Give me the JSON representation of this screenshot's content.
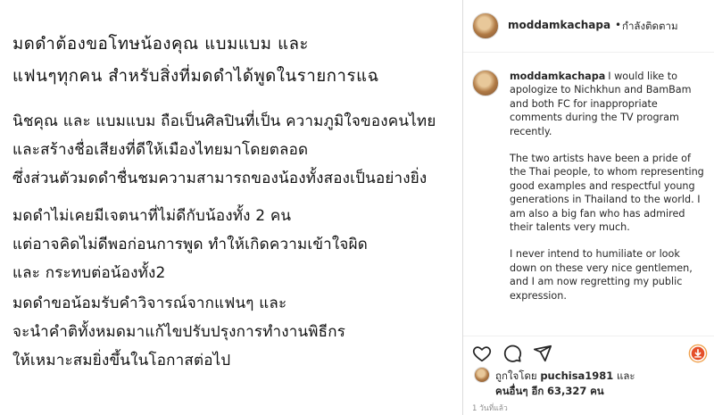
{
  "post_image": {
    "heading": [
      "มดดำต้องขอโทษน้องคุณ แบมแบม และ",
      "แฟนๆทุกคน สำหรับสิ่งที่มดดำได้พูดในรายการแฉ"
    ],
    "para1": [
      "นิชคุณ และ แบมแบม ถือเป็นศิลปินที่เป็น ความภูมิใจของคนไทย",
      "และสร้างชื่อเสียงที่ดีให้เมืองไทยมาโดยตลอด",
      "ซึ่งส่วนตัวมดดำชื่นชมความสามารถของน้องทั้งสองเป็นอย่างยิ่ง"
    ],
    "para2": [
      "มดดำไม่เคยมีเจตนาที่ไม่ดีกับน้องทั้ง 2 คน",
      "แต่อาจคิดไม่ดีพอก่อนการพูด ทำให้เกิดความเข้าใจผิด",
      " และ กระทบต่อน้องทั้ง2"
    ],
    "para3": [
      "มดดำขอน้อมรับคำวิจารณ์จากแฟนๆ และ",
      "จะนำคำติทั้งหมดมาแก้ไขปรับปรุงการทำงานพิธีกร",
      "ให้เหมาะสมยิ่งขึ้นในโอกาสต่อไป"
    ]
  },
  "header": {
    "username": "moddamkachapa",
    "separator": "•",
    "follow_status": "กำลังติดตาม"
  },
  "caption": {
    "username": "moddamkachapa",
    "paragraphs": [
      "I would like to apologize to Nichkhun and BamBam and both FC for inappropriate comments during the TV program recently.",
      "The two artists have been a pride of the Thai people, to whom representing good examples and respectful young generations in Thailand to the world. I am also a big fan who has admired their talents very much.",
      "I never intend to humiliate or look down on these very nice gentlemen, and I am now regretting my public expression."
    ]
  },
  "actions": {
    "icons": [
      "heart-icon",
      "comment-icon",
      "share-icon",
      "bookmark-icon"
    ],
    "badge_color": "#e5502a"
  },
  "likes": {
    "liked_by_prefix": "ถูกใจโดย",
    "liked_by_user": "puchisa1981",
    "and_word": "และ",
    "others_prefix": "คนอื่นๆ อีก",
    "others_count": "63,327",
    "others_suffix": "คน"
  },
  "timestamp": "1 วันที่แล้ว"
}
